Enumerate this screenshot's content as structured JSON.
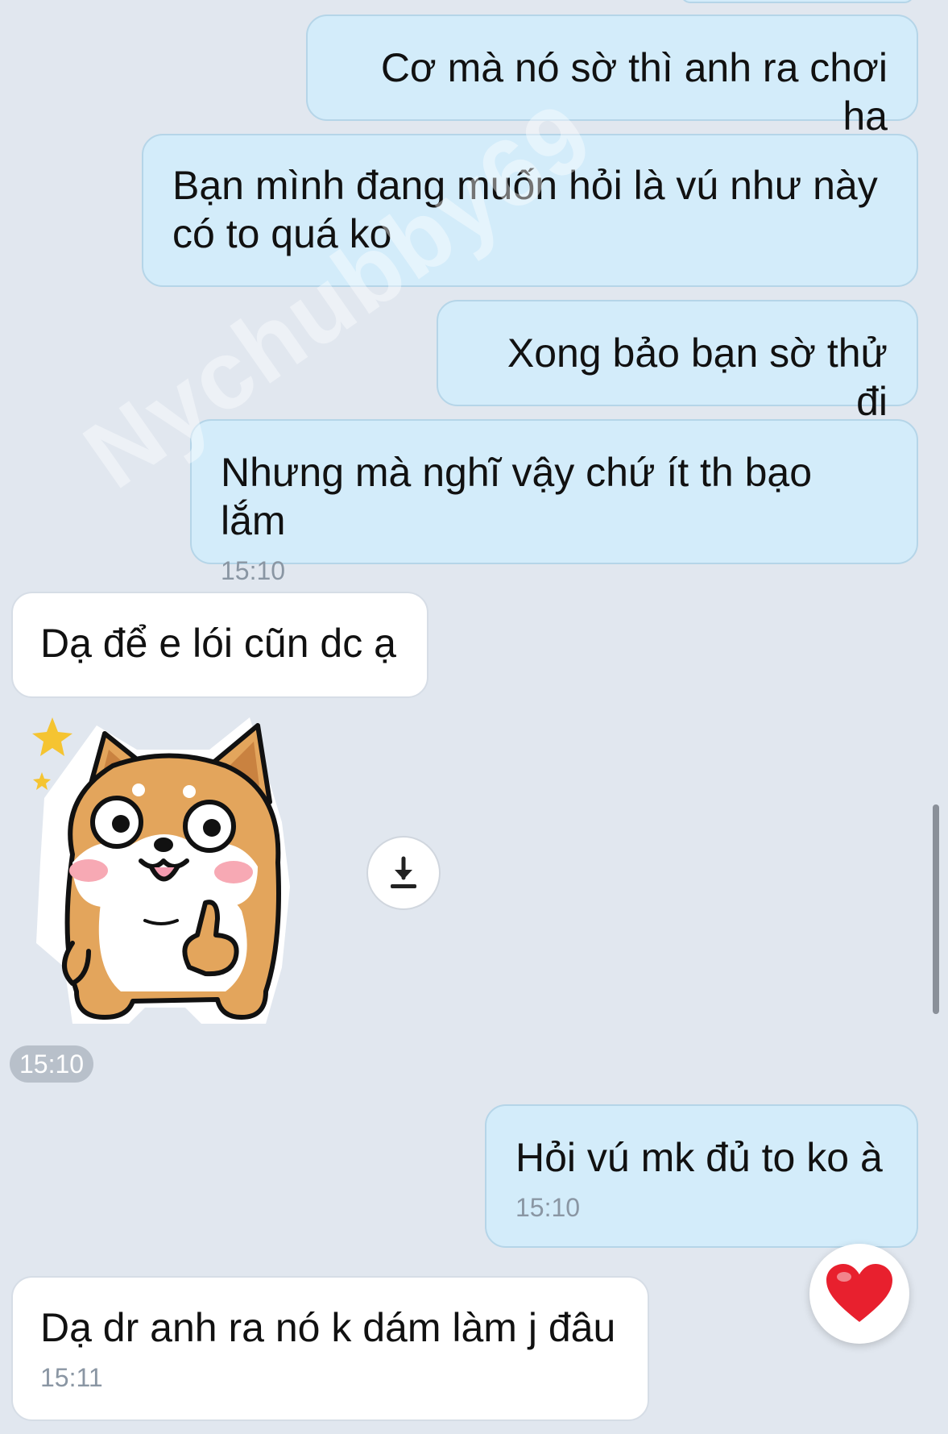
{
  "messages": [
    {
      "text": "Cơ mà nó sờ thì anh ra chơi ha"
    },
    {
      "text": "Bạn mình đang muốn hỏi là vú như này\ncó to quá ko"
    },
    {
      "text": "Xong bảo bạn sờ thử đi"
    },
    {
      "text": "Nhưng mà nghĩ vậy chứ ít th bạo lắm",
      "time": "15:10"
    },
    {
      "text": "Dạ để e lói cũn dc ạ"
    },
    {
      "text": "Hỏi vú mk đủ to ko à",
      "time": "15:10"
    },
    {
      "text": "Dạ dr anh ra nó k dám làm j đâu",
      "time": "15:11"
    }
  ],
  "sticker": {
    "description_icon": "shiba-thumbs-up-sticker",
    "time": "15:10"
  },
  "icons": {
    "download": "download-icon",
    "reaction": "heart-icon"
  },
  "colors": {
    "background": "#e1e7ef",
    "outgoing_bubble": "#d3ecfa",
    "incoming_bubble": "#ffffff",
    "heart": "#e8202e"
  },
  "watermark": "Nychubby69"
}
